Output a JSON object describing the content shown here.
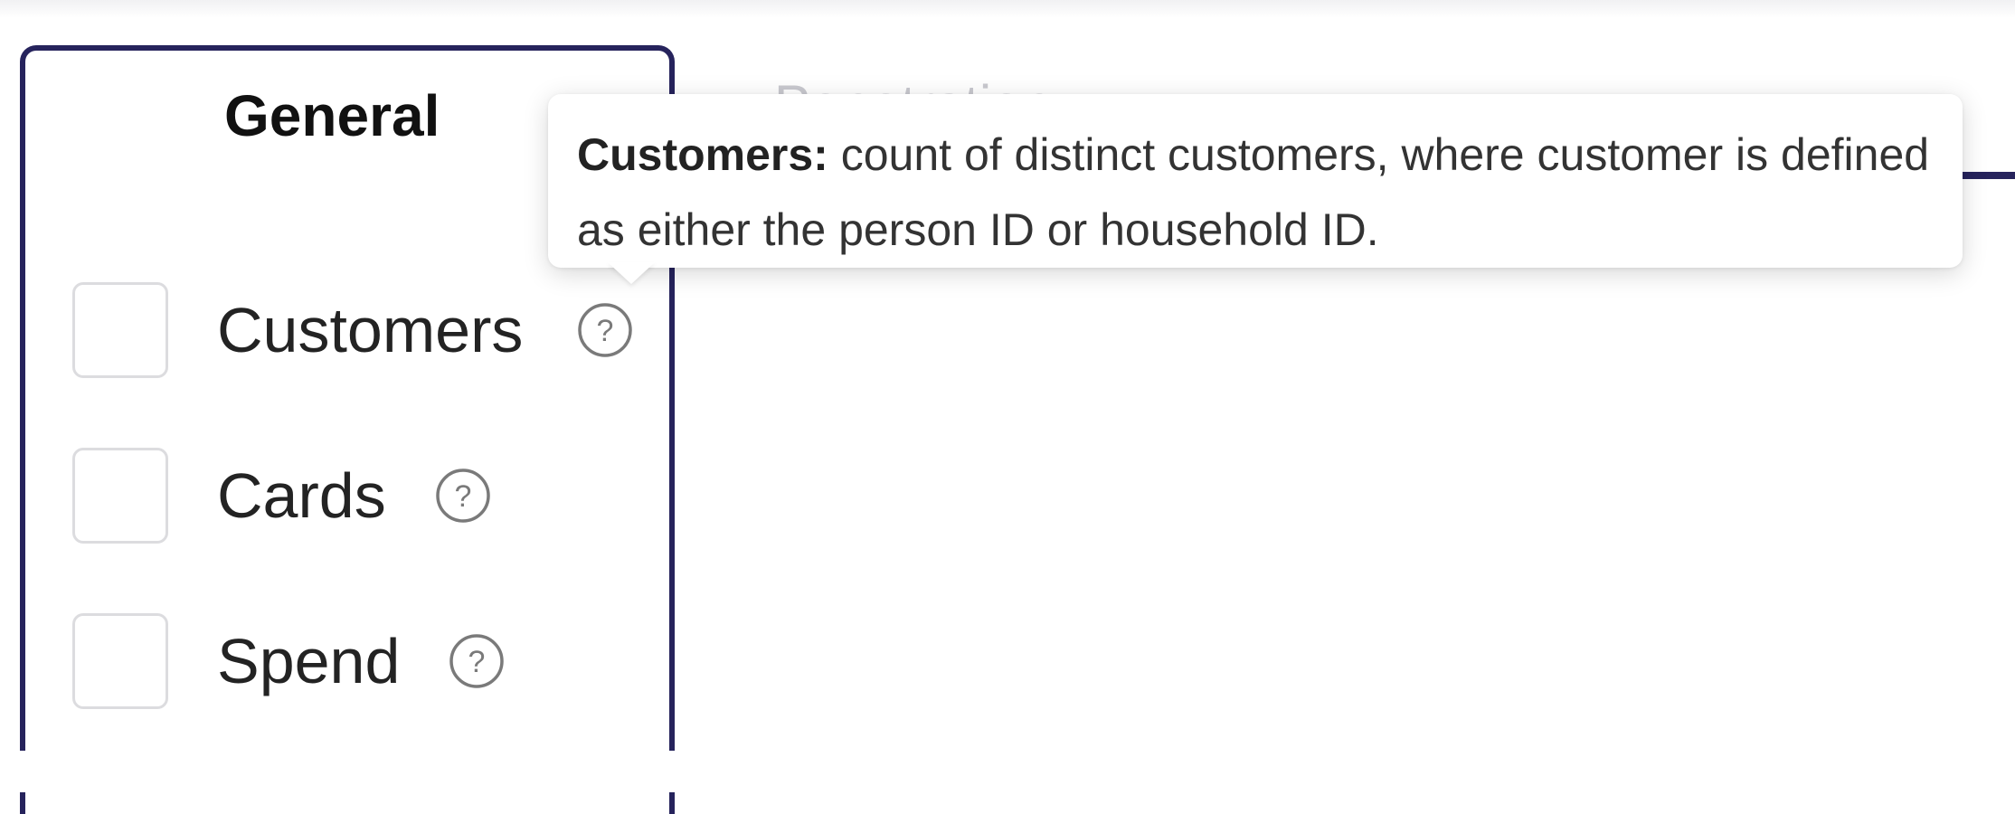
{
  "tabs": [
    {
      "label": "General",
      "active": true
    },
    {
      "label": "Penetration",
      "active": false
    }
  ],
  "tooltip": {
    "term": "Customers:",
    "text": " count of distinct customers, where customer is defined as either the person ID or household ID."
  },
  "metrics": [
    {
      "label": "Customers",
      "checked": false,
      "icon": "help-circle-icon"
    },
    {
      "label": "Cards",
      "checked": false,
      "icon": "help-circle-icon"
    },
    {
      "label": "Spend",
      "checked": false,
      "icon": "help-circle-icon"
    }
  ],
  "colors": {
    "accent": "#26235c",
    "checkbox_border": "#dcdcdf",
    "text": "#232323"
  }
}
